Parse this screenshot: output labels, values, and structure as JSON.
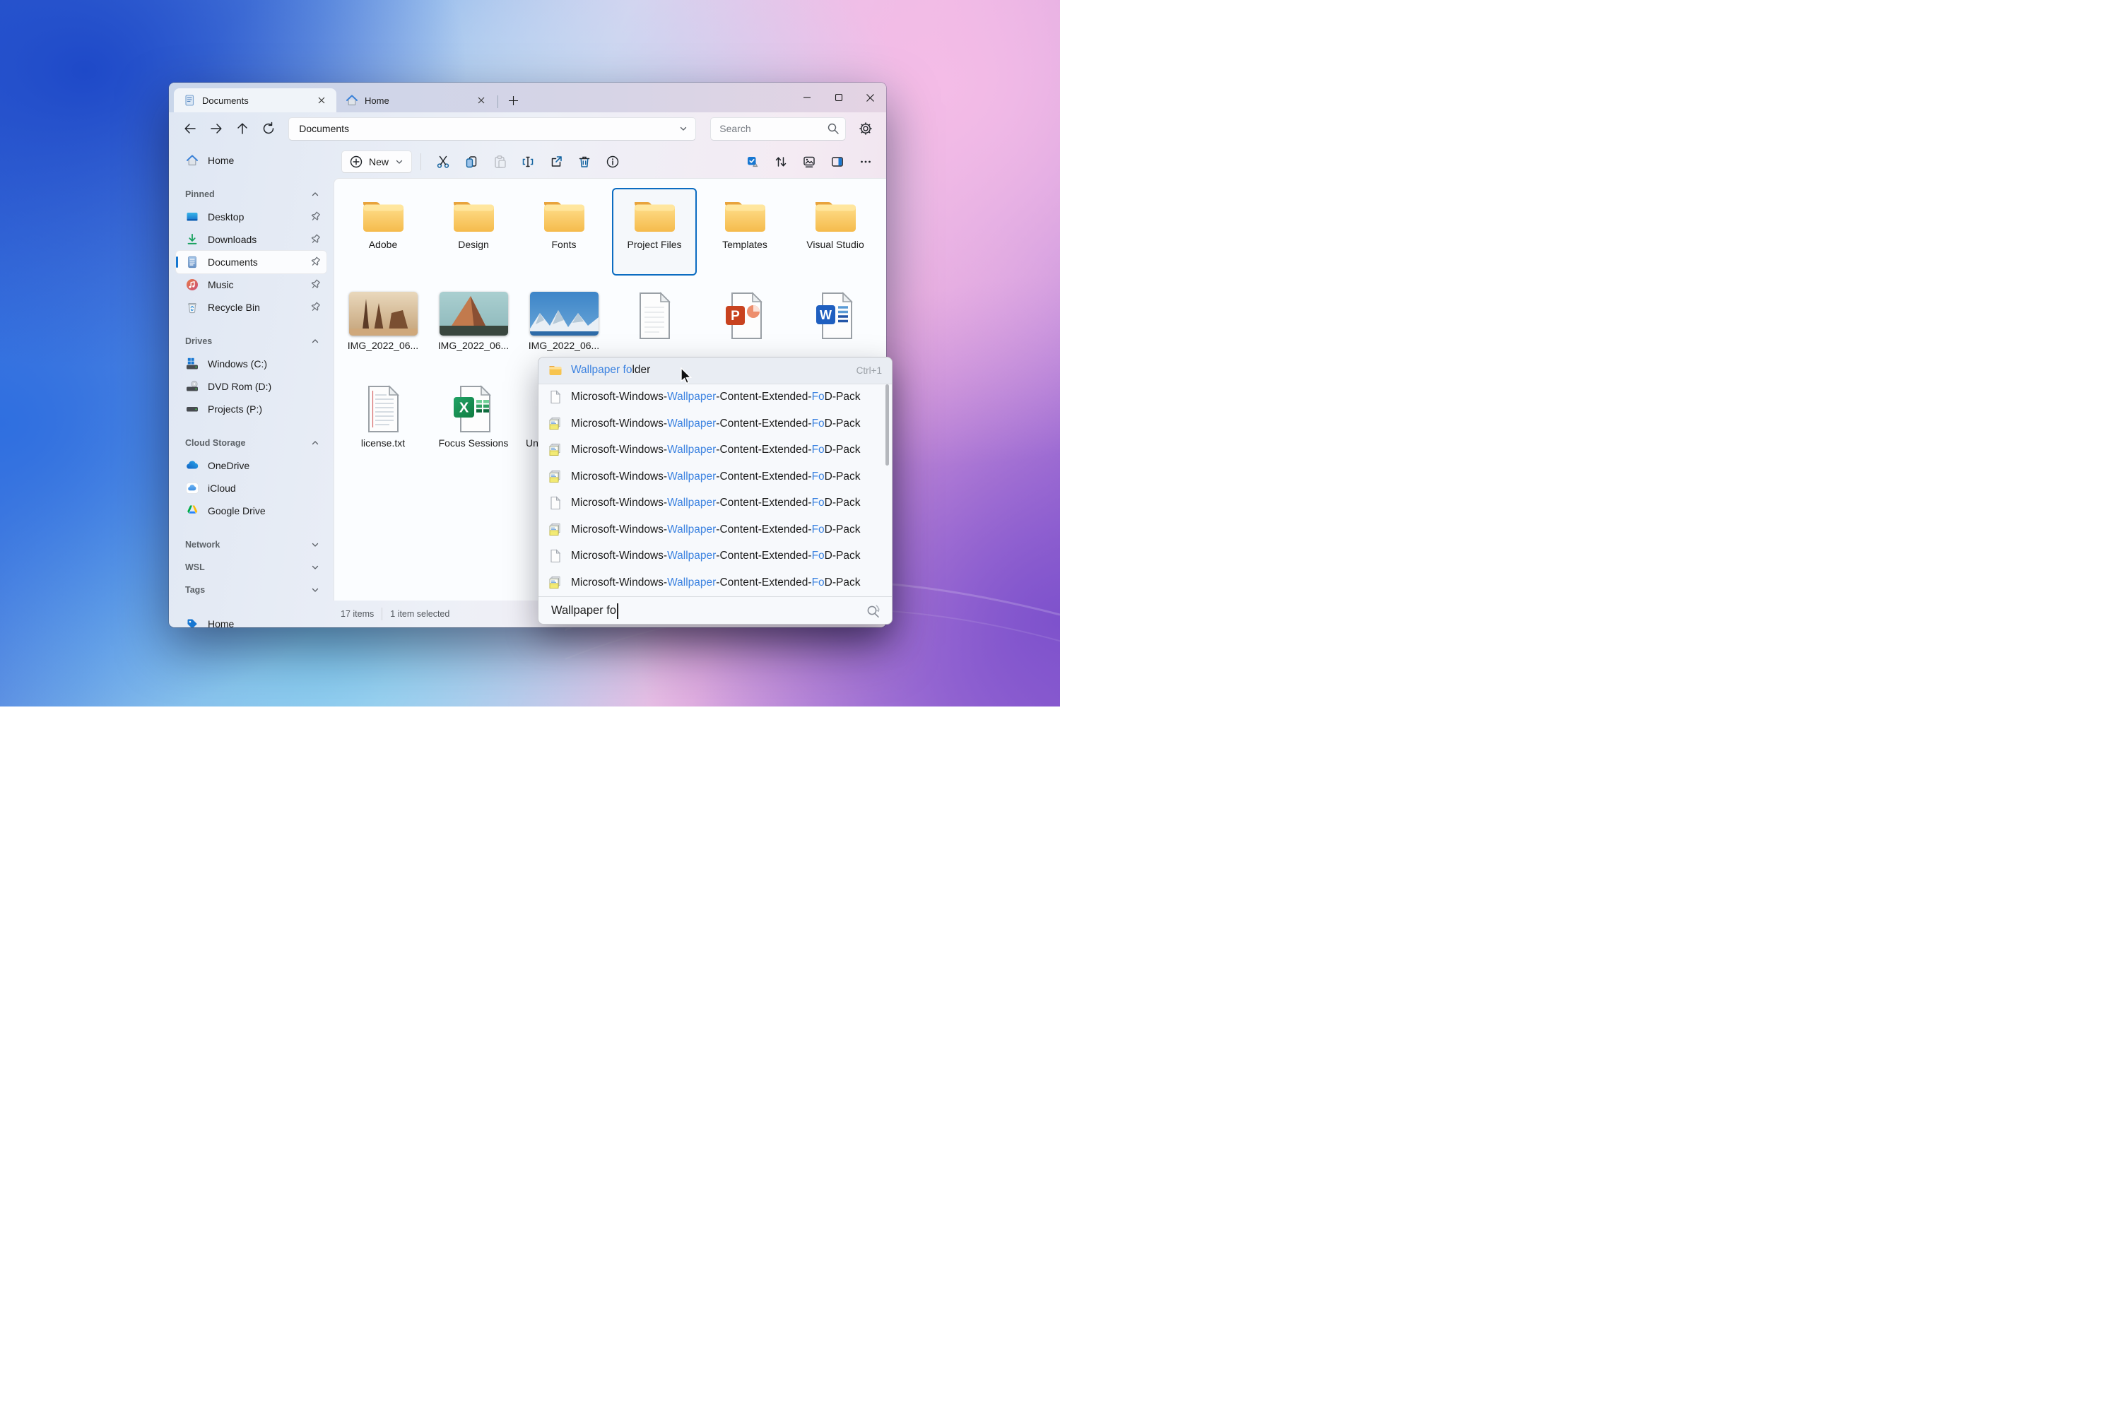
{
  "window": {
    "controls": [
      "minimize",
      "maximize",
      "close"
    ],
    "tabs": [
      {
        "icon": "doc-tab-icon",
        "label": "Documents",
        "active": true
      },
      {
        "icon": "home-tab-icon",
        "label": "Home",
        "active": false
      }
    ]
  },
  "navbar": {
    "address": "Documents",
    "search_placeholder": "Search",
    "nav_icons": [
      "back",
      "forward",
      "up",
      "refresh"
    ],
    "settings_icon": "gear"
  },
  "toolbar": {
    "new_label": "New",
    "left_icons": [
      "cut",
      "copy",
      "paste",
      "rename",
      "share",
      "delete",
      "info"
    ],
    "right_icons": [
      "select-all",
      "sort",
      "view-gallery",
      "details-pane",
      "more"
    ]
  },
  "sidebar": {
    "top_item": {
      "icon": "home",
      "label": "Home"
    },
    "sections": [
      {
        "label": "Pinned",
        "chevron": "up",
        "items": [
          {
            "icon": "desktop",
            "label": "Desktop",
            "pinned": true
          },
          {
            "icon": "downloads",
            "label": "Downloads",
            "pinned": true
          },
          {
            "icon": "documents",
            "label": "Documents",
            "pinned": true,
            "selected": true
          },
          {
            "icon": "music",
            "label": "Music",
            "pinned": true
          },
          {
            "icon": "recycle-bin",
            "label": "Recycle Bin",
            "pinned": true
          }
        ]
      },
      {
        "label": "Drives",
        "chevron": "up",
        "items": [
          {
            "icon": "drive-windows",
            "label": "Windows (C:)"
          },
          {
            "icon": "drive-dvd",
            "label": "DVD Rom (D:)"
          },
          {
            "icon": "drive",
            "label": "Projects (P:)"
          }
        ]
      },
      {
        "label": "Cloud Storage",
        "chevron": "up",
        "items": [
          {
            "icon": "onedrive",
            "label": "OneDrive"
          },
          {
            "icon": "icloud",
            "label": "iCloud"
          },
          {
            "icon": "gdrive",
            "label": "Google Drive"
          }
        ]
      }
    ],
    "collapsed_sections": [
      {
        "label": "Network",
        "chevron": "down"
      },
      {
        "label": "WSL",
        "chevron": "down"
      },
      {
        "label": "Tags",
        "chevron": "down"
      }
    ],
    "tag_item": {
      "icon": "tag",
      "label": "Home"
    }
  },
  "content": {
    "folders": [
      {
        "icon": "folder",
        "label": "Adobe"
      },
      {
        "icon": "folder",
        "label": "Design"
      },
      {
        "icon": "folder",
        "label": "Fonts"
      },
      {
        "icon": "folder",
        "label": "Project Files",
        "selected": true
      },
      {
        "icon": "folder",
        "label": "Templates"
      },
      {
        "icon": "folder",
        "label": "Visual Studio"
      }
    ],
    "row2": [
      {
        "icon": "photo-desert",
        "label": "IMG_2022_06..."
      },
      {
        "icon": "photo-peak",
        "label": "IMG_2022_06..."
      },
      {
        "icon": "photo-snow",
        "label": "IMG_2022_06..."
      },
      {
        "icon": "file-blank",
        "label": ""
      },
      {
        "icon": "file-powerpoint",
        "label": ""
      },
      {
        "icon": "file-word",
        "label": ""
      }
    ],
    "row3": [
      {
        "icon": "file-text",
        "label": "license.txt"
      },
      {
        "icon": "file-excel",
        "label": "Focus Sessions"
      },
      {
        "icon": "file-text",
        "label": "Un",
        "align": "left"
      }
    ]
  },
  "statusbar": {
    "count": "17 items",
    "selected": "1 item selected"
  },
  "dropdown": {
    "rows": [
      {
        "icon": "folder-sm",
        "selected": true,
        "shortcut": "Ctrl+1",
        "segments": [
          {
            "t": "Wallpaper fo",
            "hl": true
          },
          {
            "t": "lder",
            "hl": false
          }
        ]
      },
      {
        "icon": "file-sm",
        "segments": [
          {
            "t": "Microsoft-Windows-",
            "hl": false
          },
          {
            "t": "Wallpaper",
            "hl": true
          },
          {
            "t": "-Content-Extended-",
            "hl": false
          },
          {
            "t": "Fo",
            "hl": true
          },
          {
            "t": "D-Pack",
            "hl": false
          }
        ]
      },
      {
        "icon": "cab-sm",
        "segments": [
          {
            "t": "Microsoft-Windows-",
            "hl": false
          },
          {
            "t": "Wallpaper",
            "hl": true
          },
          {
            "t": "-Content-Extended-",
            "hl": false
          },
          {
            "t": "Fo",
            "hl": true
          },
          {
            "t": "D-Pack",
            "hl": false
          }
        ]
      },
      {
        "icon": "cab-sm",
        "segments": [
          {
            "t": "Microsoft-Windows-",
            "hl": false
          },
          {
            "t": "Wallpaper",
            "hl": true
          },
          {
            "t": "-Content-Extended-",
            "hl": false
          },
          {
            "t": "Fo",
            "hl": true
          },
          {
            "t": "D-Pack",
            "hl": false
          }
        ]
      },
      {
        "icon": "cab-sm",
        "segments": [
          {
            "t": "Microsoft-Windows-",
            "hl": false
          },
          {
            "t": "Wallpaper",
            "hl": true
          },
          {
            "t": "-Content-Extended-",
            "hl": false
          },
          {
            "t": "Fo",
            "hl": true
          },
          {
            "t": "D-Pack",
            "hl": false
          }
        ]
      },
      {
        "icon": "file-sm",
        "segments": [
          {
            "t": "Microsoft-Windows-",
            "hl": false
          },
          {
            "t": "Wallpaper",
            "hl": true
          },
          {
            "t": "-Content-Extended-",
            "hl": false
          },
          {
            "t": "Fo",
            "hl": true
          },
          {
            "t": "D-Pack",
            "hl": false
          }
        ]
      },
      {
        "icon": "cab-sm",
        "segments": [
          {
            "t": "Microsoft-Windows-",
            "hl": false
          },
          {
            "t": "Wallpaper",
            "hl": true
          },
          {
            "t": "-Content-Extended-",
            "hl": false
          },
          {
            "t": "Fo",
            "hl": true
          },
          {
            "t": "D-Pack",
            "hl": false
          }
        ]
      },
      {
        "icon": "file-sm",
        "segments": [
          {
            "t": "Microsoft-Windows-",
            "hl": false
          },
          {
            "t": "Wallpaper",
            "hl": true
          },
          {
            "t": "-Content-Extended-",
            "hl": false
          },
          {
            "t": "Fo",
            "hl": true
          },
          {
            "t": "D-Pack",
            "hl": false
          }
        ]
      },
      {
        "icon": "cab-sm",
        "segments": [
          {
            "t": "Microsoft-Windows-",
            "hl": false
          },
          {
            "t": "Wallpaper",
            "hl": true
          },
          {
            "t": "-Content-Extended-",
            "hl": false
          },
          {
            "t": "Fo",
            "hl": true
          },
          {
            "t": "D-Pack",
            "hl": false
          }
        ]
      }
    ],
    "query": "Wallpaper fo"
  },
  "colors": {
    "accent": "#0b6cc1",
    "highlight_text": "#3b82e0",
    "folder_yellow": "#f6c14f"
  }
}
